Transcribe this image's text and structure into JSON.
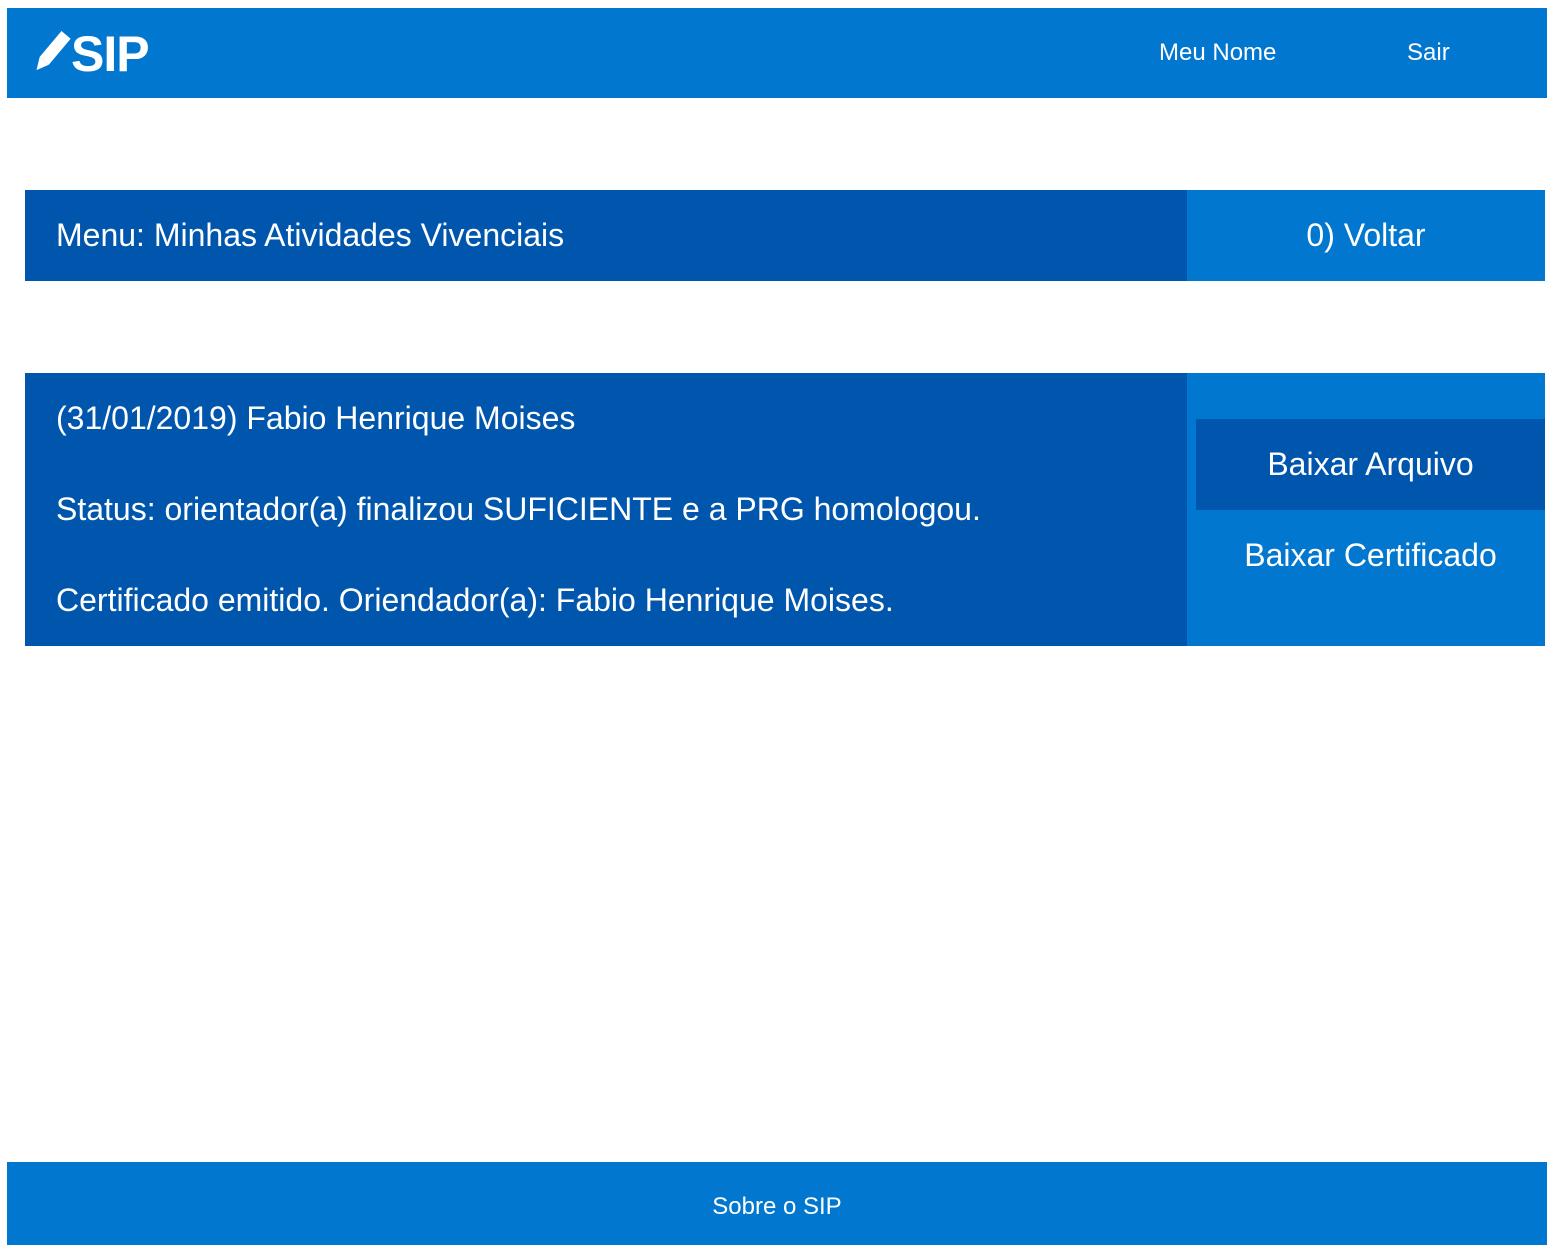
{
  "header": {
    "logo_text": "SIP",
    "logo_icon": "pencil-icon",
    "nav": {
      "meu_nome": "Meu Nome",
      "sair": "Sair"
    }
  },
  "menu": {
    "title": "Menu: Minhas Atividades Vivenciais",
    "back_label": "0) Voltar"
  },
  "activities": [
    {
      "title": "(31/01/2019) Fabio Henrique Moises",
      "status": "Status: orientador(a) finalizou SUFICIENTE e a PRG homologou.",
      "detail": "Certificado emitido. Oriendador(a): Fabio Henrique Moises.",
      "download_file_label": "Baixar Arquivo",
      "download_certificate_label": "Baixar Certificado"
    }
  ],
  "footer": {
    "about_label": "Sobre o SIP"
  },
  "colors": {
    "primary": "#0277cf",
    "dark": "#0056ad",
    "text": "#ffffff"
  }
}
